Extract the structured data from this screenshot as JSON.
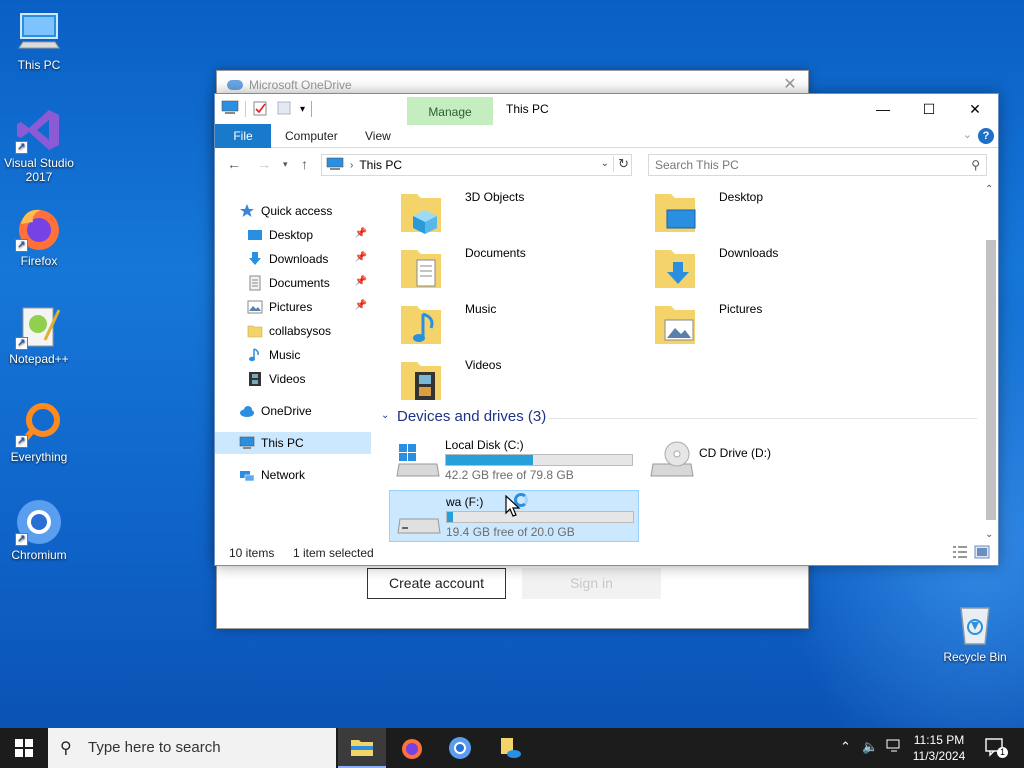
{
  "desktop": {
    "icons": [
      {
        "label": "This PC"
      },
      {
        "label": "Visual Studio 2017"
      },
      {
        "label": "Firefox"
      },
      {
        "label": "Notepad++"
      },
      {
        "label": "Everything"
      },
      {
        "label": "Chromium"
      },
      {
        "label": "Recycle Bin"
      }
    ]
  },
  "onedrive": {
    "title": "Microsoft OneDrive",
    "create_account": "Create account",
    "sign_in": "Sign in"
  },
  "explorer": {
    "manage_tab": "Manage",
    "title": "This PC",
    "ribbon_tabs": [
      "File",
      "Computer",
      "View"
    ],
    "address": "This PC",
    "search_placeholder": "Search This PC",
    "nav": {
      "quick_access": "Quick access",
      "items": [
        "Desktop",
        "Downloads",
        "Documents",
        "Pictures",
        "collabsysos",
        "Music",
        "Videos"
      ],
      "onedrive": "OneDrive",
      "this_pc": "This PC",
      "network": "Network"
    },
    "folders": [
      "3D Objects",
      "Desktop",
      "Documents",
      "Downloads",
      "Music",
      "Pictures",
      "Videos"
    ],
    "devices_header": "Devices and drives (3)",
    "drives": [
      {
        "name": "Local Disk (C:)",
        "free": "42.2 GB free of 79.8 GB",
        "used_fraction": 0.47
      },
      {
        "name": "CD Drive (D:)"
      },
      {
        "name": "wa (F:)",
        "free": "19.4 GB free of 20.0 GB",
        "used_fraction": 0.03
      }
    ],
    "status": {
      "items": "10 items",
      "selected": "1 item selected"
    }
  },
  "taskbar": {
    "search_placeholder": "Type here to search",
    "time": "11:15 PM",
    "date": "11/3/2024",
    "notification_count": "1"
  }
}
